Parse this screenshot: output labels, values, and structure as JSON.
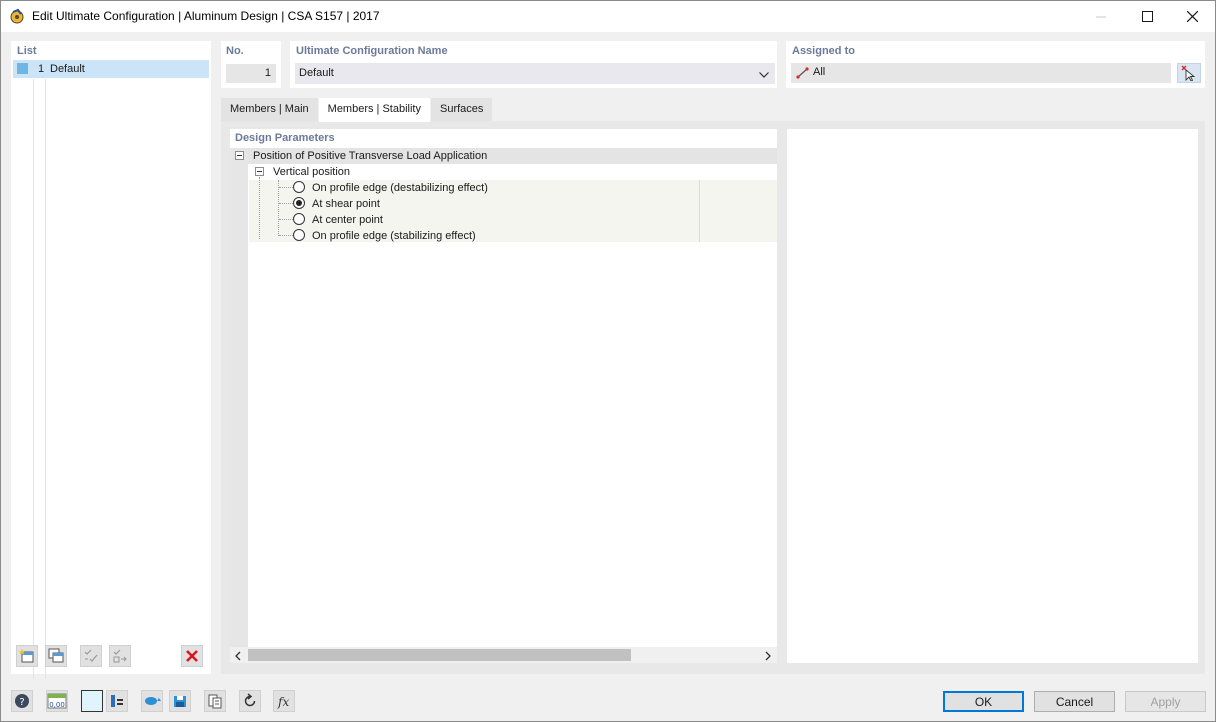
{
  "window": {
    "title": "Edit Ultimate Configuration | Aluminum Design | CSA S157 | 2017"
  },
  "list": {
    "label": "List",
    "items": [
      {
        "number": "1",
        "name": "Default",
        "color": "#6fb6e6"
      }
    ]
  },
  "number": {
    "label": "No.",
    "value": "1"
  },
  "config_name": {
    "label": "Ultimate Configuration Name",
    "value": "Default"
  },
  "assigned": {
    "label": "Assigned to",
    "value": "All"
  },
  "tabs": [
    {
      "label": "Members | Main"
    },
    {
      "label": "Members | Stability",
      "active": true
    },
    {
      "label": "Surfaces"
    }
  ],
  "design_parameters": {
    "label": "Design Parameters",
    "group": "Position of Positive Transverse Load Application",
    "subgroup": "Vertical position",
    "options": [
      {
        "label": "On profile edge (destabilizing effect)",
        "selected": false
      },
      {
        "label": "At shear point",
        "selected": true
      },
      {
        "label": "At center point",
        "selected": false
      },
      {
        "label": "On profile edge (stabilizing effect)",
        "selected": false
      }
    ]
  },
  "buttons": {
    "ok": "OK",
    "cancel": "Cancel",
    "apply": "Apply"
  },
  "bottom_number_icon_text": "0,00"
}
